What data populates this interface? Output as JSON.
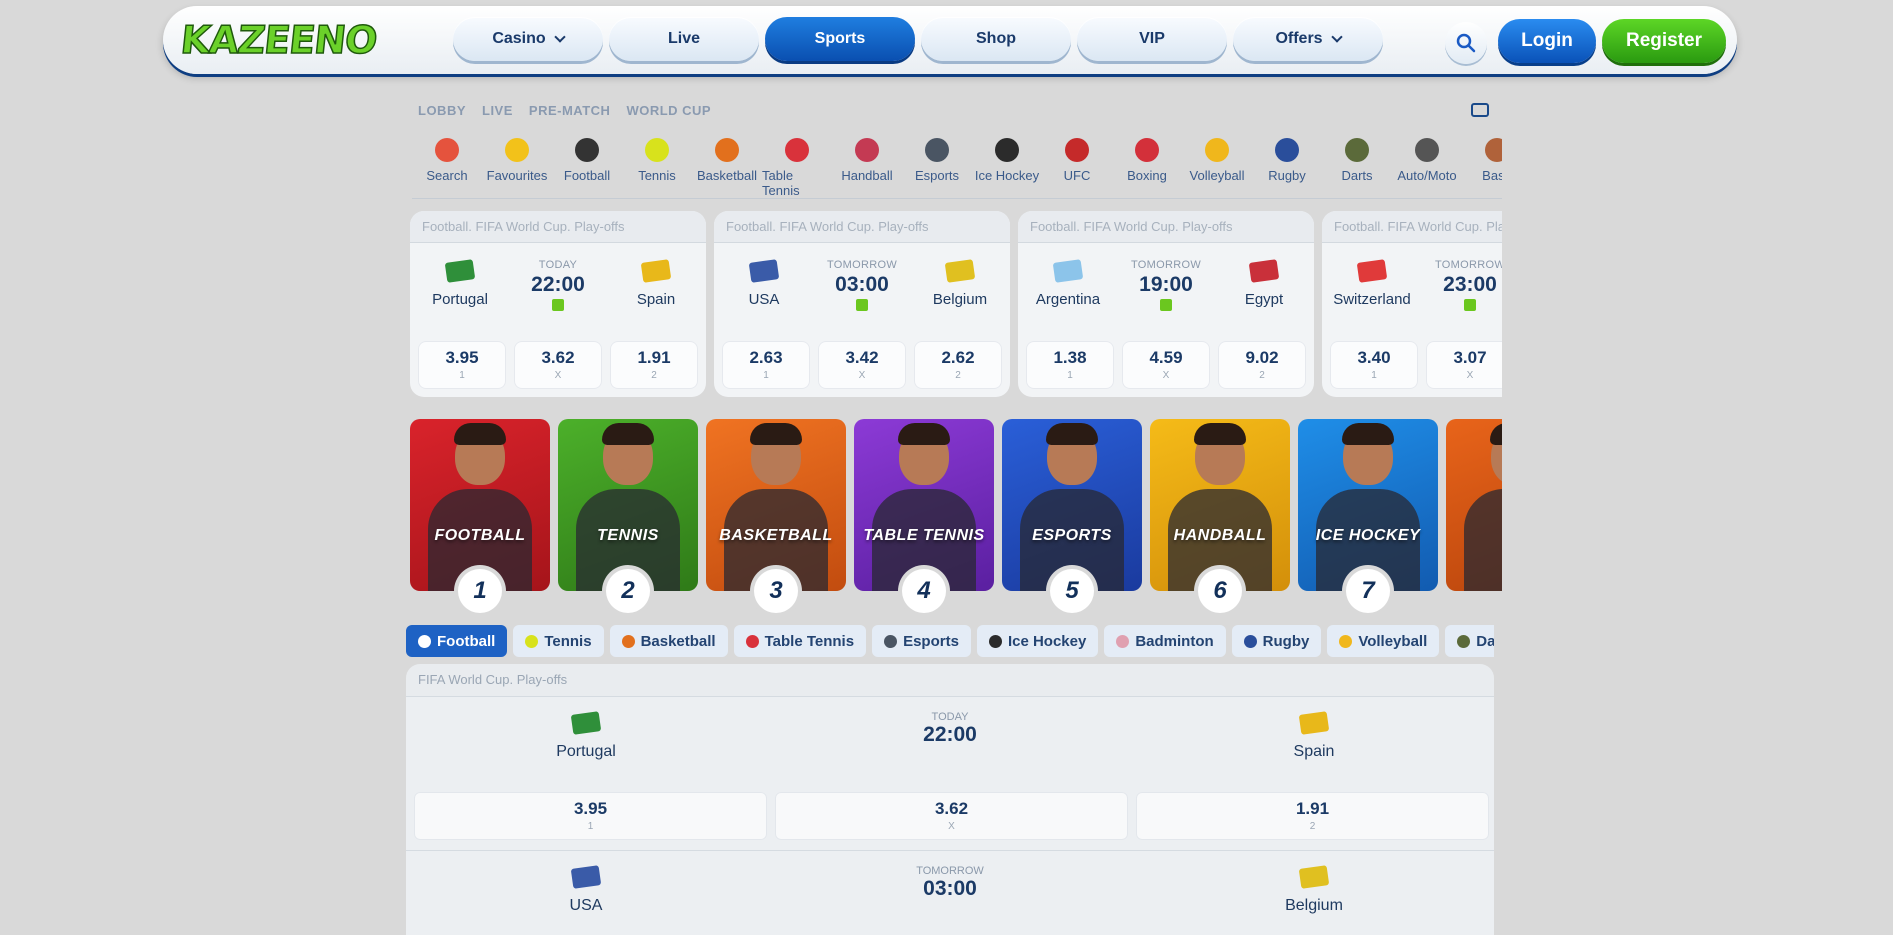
{
  "header": {
    "logo": "KAZEENO",
    "nav": [
      {
        "label": "Casino",
        "dropdown": true,
        "active": false
      },
      {
        "label": "Live",
        "dropdown": false,
        "active": false
      },
      {
        "label": "Sports",
        "dropdown": false,
        "active": true
      },
      {
        "label": "Shop",
        "dropdown": false,
        "active": false
      },
      {
        "label": "VIP",
        "dropdown": false,
        "active": false
      },
      {
        "label": "Offers",
        "dropdown": true,
        "active": false
      }
    ],
    "login": "Login",
    "register": "Register"
  },
  "toplinks": [
    "LOBBY",
    "LIVE",
    "PRE-MATCH",
    "WORLD CUP"
  ],
  "sports": [
    {
      "label": "Search",
      "icon": "search-icon",
      "color": "#e5533d"
    },
    {
      "label": "Favourites",
      "icon": "star-icon",
      "color": "#f2c21a"
    },
    {
      "label": "Football",
      "icon": "football-icon",
      "color": "#333333"
    },
    {
      "label": "Tennis",
      "icon": "tennis-ball-icon",
      "color": "#d8e21c"
    },
    {
      "label": "Basketball",
      "icon": "basketball-icon",
      "color": "#e2701d"
    },
    {
      "label": "Table Tennis",
      "icon": "table-tennis-icon",
      "color": "#d9323b"
    },
    {
      "label": "Handball",
      "icon": "handball-icon",
      "color": "#c43a53"
    },
    {
      "label": "Esports",
      "icon": "gamepad-icon",
      "color": "#4a5563"
    },
    {
      "label": "Ice Hockey",
      "icon": "puck-icon",
      "color": "#2b2b2b"
    },
    {
      "label": "UFC",
      "icon": "glove-icon",
      "color": "#c52a2a"
    },
    {
      "label": "Boxing",
      "icon": "boxing-glove-icon",
      "color": "#d3303a"
    },
    {
      "label": "Volleyball",
      "icon": "volleyball-icon",
      "color": "#f0b71c"
    },
    {
      "label": "Rugby",
      "icon": "rugby-ball-icon",
      "color": "#2a4e9b"
    },
    {
      "label": "Darts",
      "icon": "dartboard-icon",
      "color": "#5b6a3a"
    },
    {
      "label": "Auto/Moto",
      "icon": "racing-flags-icon",
      "color": "#555555"
    },
    {
      "label": "Base",
      "icon": "baseball-icon",
      "color": "#b0623a"
    }
  ],
  "cards": [
    {
      "league": "Football. FIFA World Cup. Play-offs",
      "home": "Portugal",
      "away": "Spain",
      "day": "TODAY",
      "time": "22:00",
      "home_flag": "#2f8f3a",
      "away_flag": "#e8b81a",
      "odds": [
        {
          "v": "3.95",
          "l": "1"
        },
        {
          "v": "3.62",
          "l": "X"
        },
        {
          "v": "1.91",
          "l": "2"
        }
      ]
    },
    {
      "league": "Football. FIFA World Cup. Play-offs",
      "home": "USA",
      "away": "Belgium",
      "day": "TOMORROW",
      "time": "03:00",
      "home_flag": "#3a5ba8",
      "away_flag": "#e0c020",
      "odds": [
        {
          "v": "2.63",
          "l": "1"
        },
        {
          "v": "3.42",
          "l": "X"
        },
        {
          "v": "2.62",
          "l": "2"
        }
      ]
    },
    {
      "league": "Football. FIFA World Cup. Play-offs",
      "home": "Argentina",
      "away": "Egypt",
      "day": "TOMORROW",
      "time": "19:00",
      "home_flag": "#8cc4ea",
      "away_flag": "#c9303a",
      "odds": [
        {
          "v": "1.38",
          "l": "1"
        },
        {
          "v": "4.59",
          "l": "X"
        },
        {
          "v": "9.02",
          "l": "2"
        }
      ]
    },
    {
      "league": "Football. FIFA World Cup. Play-offs",
      "home": "Switzerland",
      "away": "",
      "day": "TOMORROW",
      "time": "23:00",
      "home_flag": "#e03a3a",
      "away_flag": "#cccccc",
      "odds": [
        {
          "v": "3.40",
          "l": "1"
        },
        {
          "v": "3.07",
          "l": "X"
        }
      ]
    }
  ],
  "tiles": [
    {
      "label": "FOOTBALL",
      "num": "1",
      "bg": "#d9232b",
      "bg2": "#a5141a"
    },
    {
      "label": "TENNIS",
      "num": "2",
      "bg": "#4cb02a",
      "bg2": "#2f7a18"
    },
    {
      "label": "BASKETBALL",
      "num": "3",
      "bg": "#f07322",
      "bg2": "#c24c0f"
    },
    {
      "label": "TABLE TENNIS",
      "num": "4",
      "bg": "#8c3ad6",
      "bg2": "#5a1fa0"
    },
    {
      "label": "ESPORTS",
      "num": "5",
      "bg": "#2a5fd8",
      "bg2": "#1a3a9e"
    },
    {
      "label": "HANDBALL",
      "num": "6",
      "bg": "#f5bb18",
      "bg2": "#d38f0a"
    },
    {
      "label": "ICE HOCKEY",
      "num": "7",
      "bg": "#1f8ee8",
      "bg2": "#125bb0"
    },
    {
      "label": "",
      "num": "",
      "bg": "#e8641a",
      "bg2": "#b8440c"
    }
  ],
  "tabs": [
    {
      "label": "Football",
      "active": true,
      "color": "#ffffff"
    },
    {
      "label": "Tennis",
      "active": false,
      "color": "#d8e21c"
    },
    {
      "label": "Basketball",
      "active": false,
      "color": "#e2701d"
    },
    {
      "label": "Table Tennis",
      "active": false,
      "color": "#d9323b"
    },
    {
      "label": "Esports",
      "active": false,
      "color": "#4a5563"
    },
    {
      "label": "Ice Hockey",
      "active": false,
      "color": "#2b2b2b"
    },
    {
      "label": "Badminton",
      "active": false,
      "color": "#e0a0b0"
    },
    {
      "label": "Rugby",
      "active": false,
      "color": "#2a4e9b"
    },
    {
      "label": "Volleyball",
      "active": false,
      "color": "#f0b71c"
    },
    {
      "label": "Darts",
      "active": false,
      "color": "#5b6a3a"
    }
  ],
  "league": {
    "title": "FIFA World Cup. Play-offs",
    "matches": [
      {
        "home": "Portugal",
        "away": "Spain",
        "day": "TODAY",
        "time": "22:00",
        "home_flag": "#2f8f3a",
        "away_flag": "#e8b81a",
        "odds": [
          {
            "v": "3.95",
            "l": "1"
          },
          {
            "v": "3.62",
            "l": "X"
          },
          {
            "v": "1.91",
            "l": "2"
          }
        ]
      },
      {
        "home": "USA",
        "away": "Belgium",
        "day": "TOMORROW",
        "time": "03:00",
        "home_flag": "#3a5ba8",
        "away_flag": "#e0c020",
        "odds": []
      }
    ]
  }
}
